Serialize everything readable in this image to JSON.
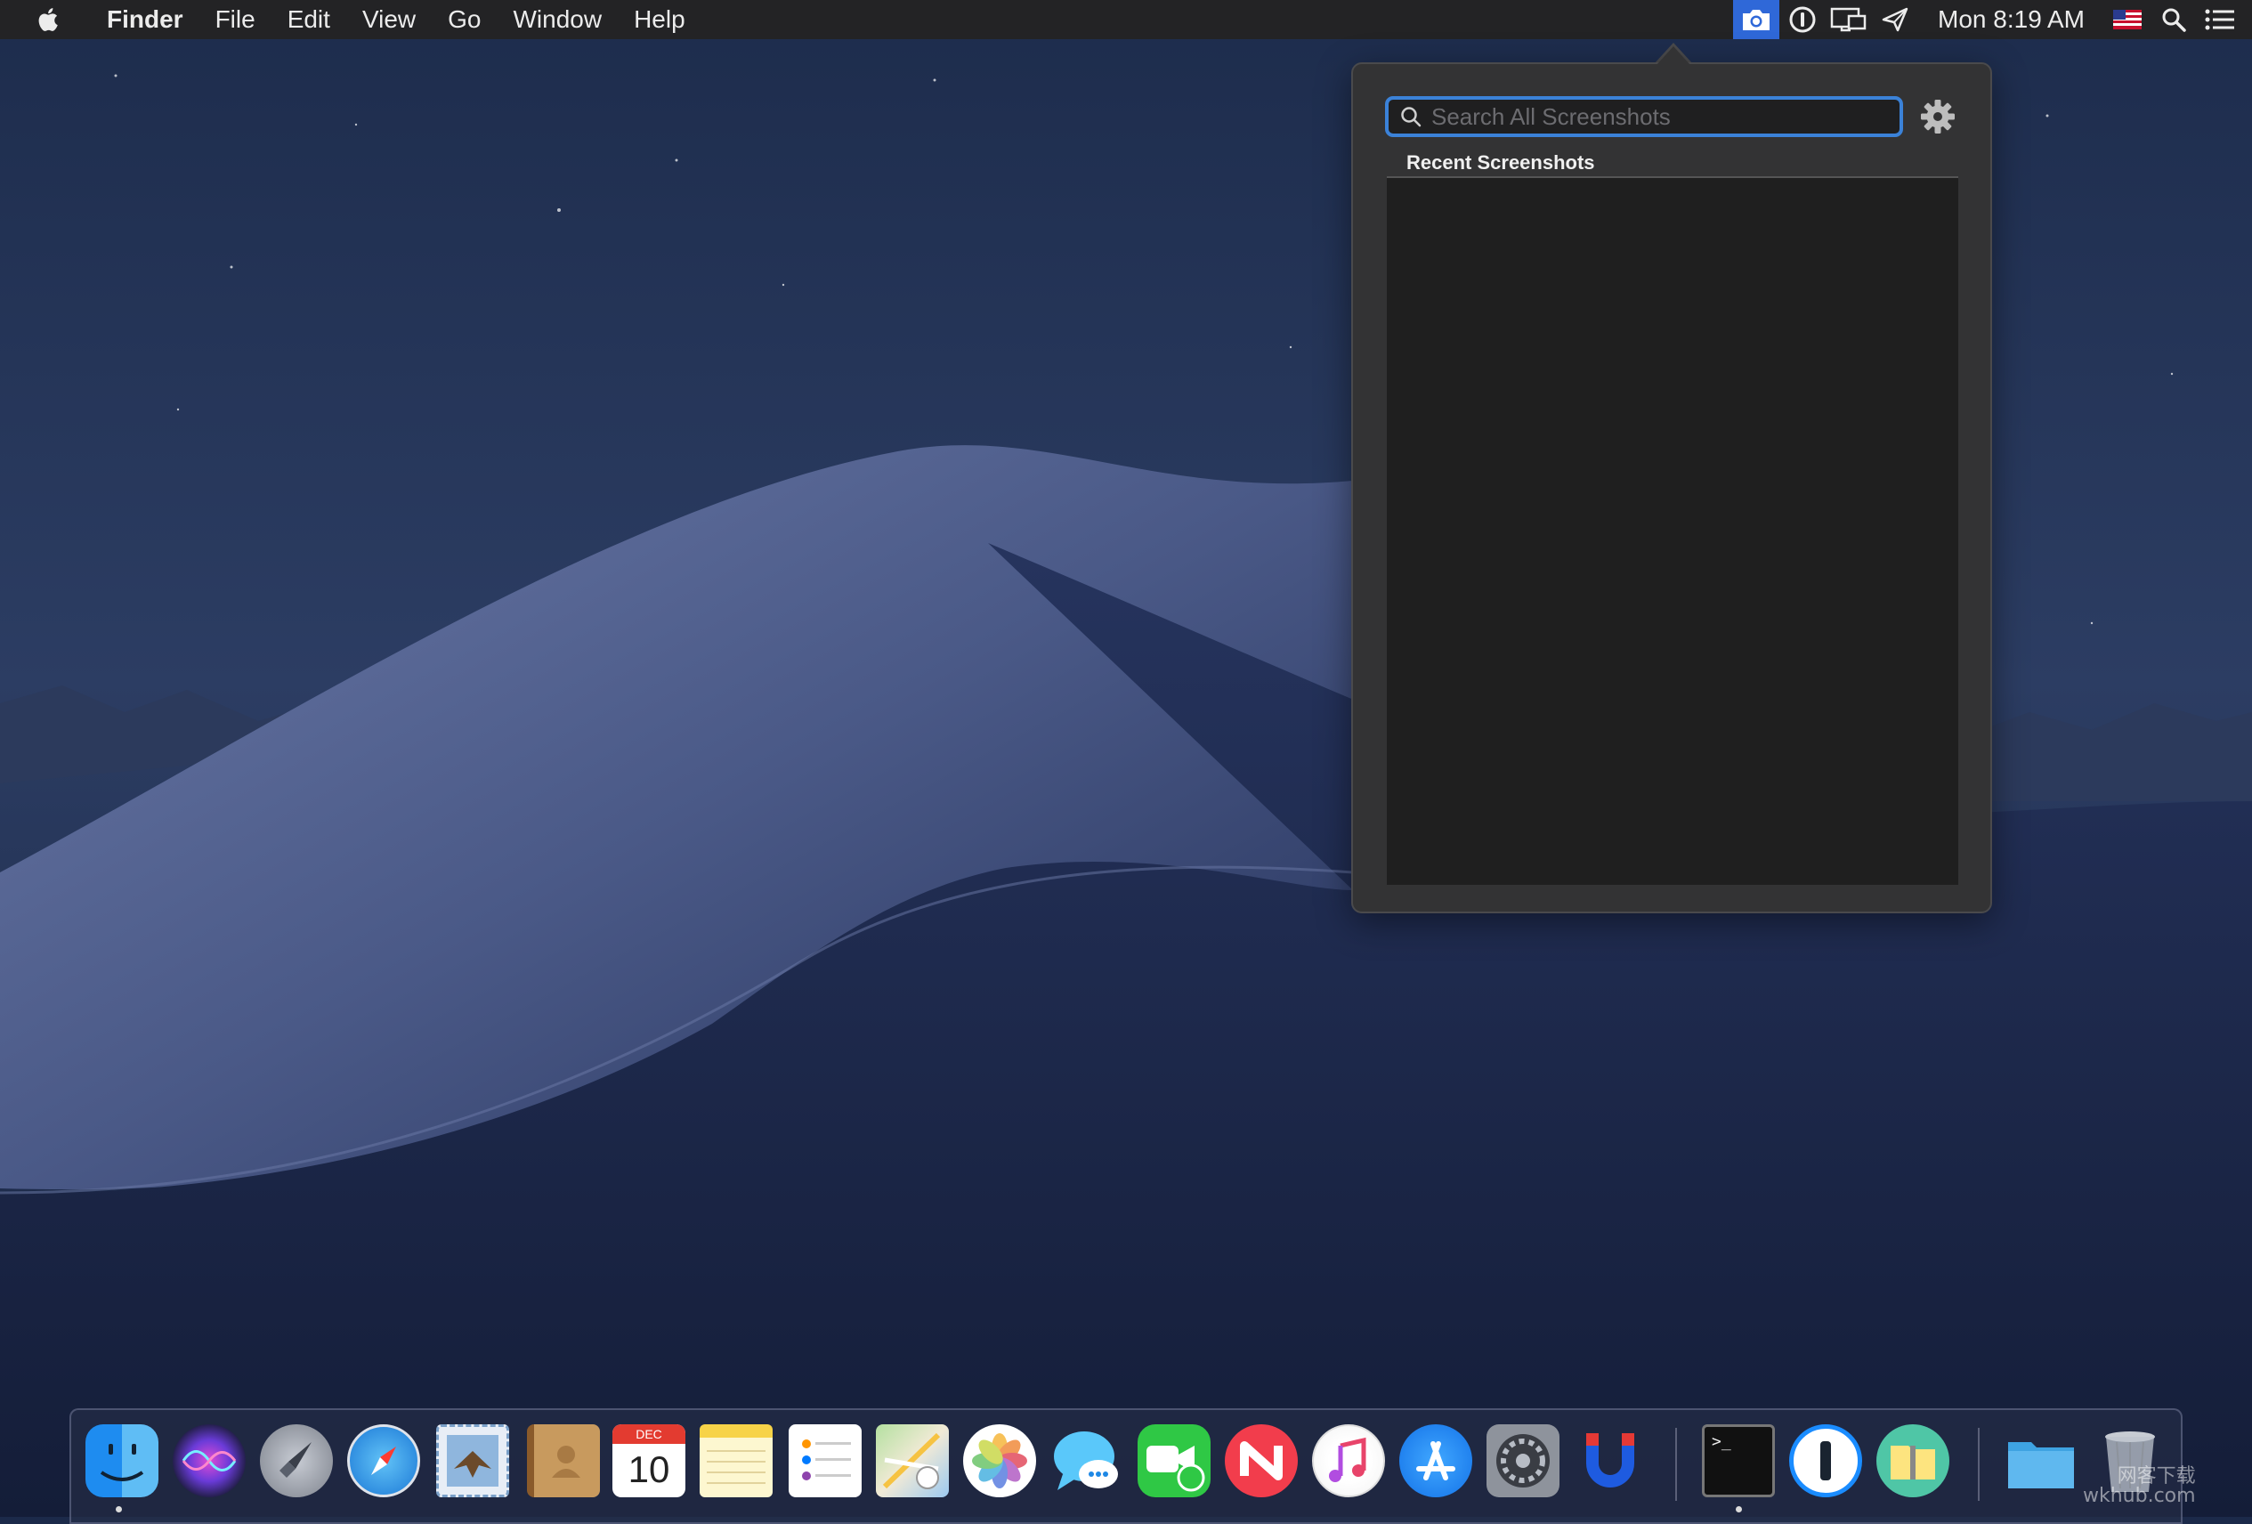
{
  "menubar": {
    "app_name": "Finder",
    "menus": [
      "File",
      "Edit",
      "View",
      "Go",
      "Window",
      "Help"
    ],
    "clock": "Mon 8:19 AM",
    "status_icons": [
      "camera-icon",
      "onepassword-icon",
      "display-mirror-icon",
      "location-icon",
      "us-flag-icon",
      "spotlight-icon",
      "notification-center-icon"
    ]
  },
  "popover": {
    "search_placeholder": "Search All Screenshots",
    "search_value": "",
    "section_label": "Recent Screenshots"
  },
  "dock": {
    "apps": [
      "finder",
      "siri",
      "launchpad",
      "safari",
      "mail",
      "contacts",
      "calendar",
      "notes",
      "reminders",
      "maps",
      "photos",
      "messages",
      "facetime",
      "news",
      "itunes",
      "app-store",
      "system-preferences",
      "magnet",
      "terminal",
      "1password",
      "archiver",
      "downloads-folder",
      "trash"
    ],
    "calendar_month": "DEC",
    "calendar_day": "10",
    "terminal_prompt": ">_"
  },
  "watermark": {
    "line1": "网客下载",
    "line2": "wkhub.com"
  },
  "colors": {
    "menubar": "#232325",
    "accent": "#2f68d8",
    "search_focus": "#3b82d8",
    "popover_bg": "#333334"
  }
}
